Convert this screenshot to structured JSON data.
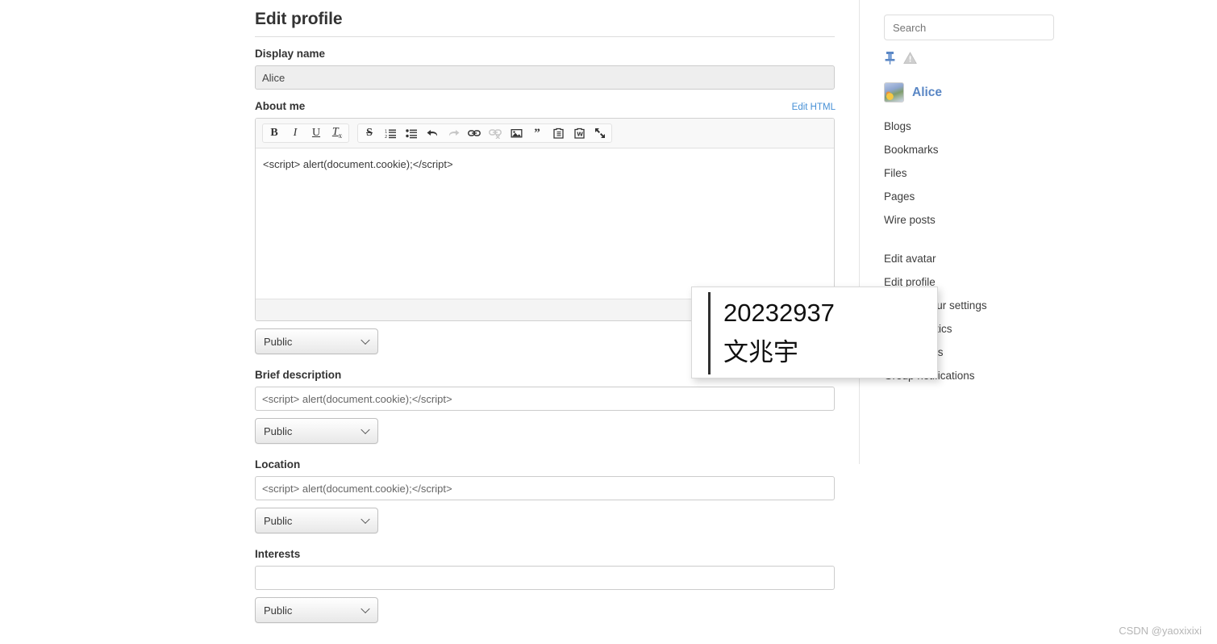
{
  "main": {
    "page_title": "Edit profile",
    "display_name": {
      "label": "Display name",
      "value": "Alice"
    },
    "about_me": {
      "label": "About me",
      "edit_html_link": "Edit HTML",
      "content": "<script> alert(document.cookie);</script>",
      "toolbar": {
        "group1": [
          {
            "name": "bold-button",
            "glyph": "B",
            "title": "Bold"
          },
          {
            "name": "italic-button",
            "glyph": "I",
            "title": "Italic"
          },
          {
            "name": "underline-button",
            "glyph": "U",
            "title": "Underline"
          },
          {
            "name": "remove-format-button",
            "glyph": "Tx",
            "title": "Remove Format"
          }
        ],
        "group2": [
          {
            "name": "strikethrough-button",
            "glyph": "S",
            "title": "Strikethrough"
          },
          {
            "name": "numbered-list-button",
            "glyph": "1.",
            "title": "Insert/Remove Numbered List"
          },
          {
            "name": "bulleted-list-button",
            "glyph": "•",
            "title": "Insert/Remove Bulleted List"
          },
          {
            "name": "undo-button",
            "glyph": "↩",
            "title": "Undo"
          },
          {
            "name": "redo-button",
            "glyph": "↪",
            "title": "Redo"
          },
          {
            "name": "link-button",
            "glyph": "link",
            "title": "Link"
          },
          {
            "name": "unlink-button",
            "glyph": "unlink",
            "title": "Unlink"
          },
          {
            "name": "image-button",
            "glyph": "image",
            "title": "Image"
          },
          {
            "name": "blockquote-button",
            "glyph": "”",
            "title": "Block Quote"
          },
          {
            "name": "paste-as-text-button",
            "glyph": "clipboard",
            "title": "Paste as plain text"
          },
          {
            "name": "paste-from-word-button",
            "glyph": "clipboard-w",
            "title": "Paste from Word"
          },
          {
            "name": "maximize-button",
            "glyph": "expand",
            "title": "Maximize"
          }
        ]
      },
      "access": "Public"
    },
    "brief_description": {
      "label": "Brief description",
      "value": "<script> alert(document.cookie);</script>",
      "access": "Public"
    },
    "location": {
      "label": "Location",
      "value": "<script> alert(document.cookie);</script>",
      "access": "Public"
    },
    "interests": {
      "label": "Interests",
      "value": "",
      "access": "Public"
    }
  },
  "sidebar": {
    "search_placeholder": "Search",
    "icons": [
      {
        "name": "pin-icon",
        "color": "#5a87c5"
      },
      {
        "name": "warning-icon",
        "color": "#cccccc"
      }
    ],
    "user": {
      "name": "Alice"
    },
    "nav_group_1": [
      "Blogs",
      "Bookmarks",
      "Files",
      "Pages",
      "Wire posts"
    ],
    "nav_group_2": [
      "Edit avatar",
      "Edit profile",
      "Change your settings",
      "View statistics",
      "Notifications",
      "Group notifications"
    ]
  },
  "popup": {
    "line1": "20232937",
    "line2": "文兆宇"
  },
  "watermark": "CSDN @yaoxixixi",
  "colors": {
    "link": "#4690d6",
    "username": "#5a87c5",
    "pin": "#5a87c5",
    "text": "#333333"
  }
}
